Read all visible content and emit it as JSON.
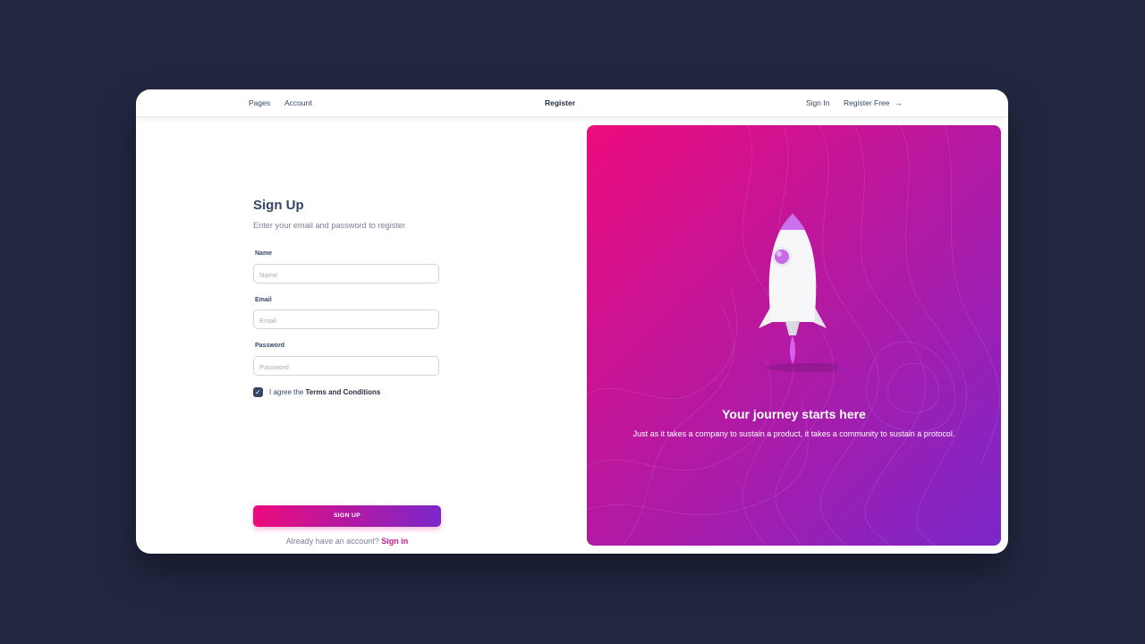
{
  "nav": {
    "pages": "Pages",
    "account": "Account",
    "title": "Register",
    "sign_in": "Sign In",
    "register_free": "Register Free",
    "arrow_icon": "arrow-right-icon"
  },
  "form": {
    "title": "Sign Up",
    "subtitle": "Enter your email and password to register",
    "name_label": "Name",
    "name_placeholder": "Name",
    "email_label": "Email",
    "email_placeholder": "Email",
    "password_label": "Password",
    "password_placeholder": "Password",
    "agree_prefix": "I agree the ",
    "agree_link": "Terms and Conditions",
    "agree_checked": true,
    "submit_label": "SIGN UP",
    "footer_text": "Already have an account? ",
    "footer_link": "Sign in"
  },
  "hero": {
    "title": "Your journey starts here",
    "text": "Just as it takes a company to sustain a product, it takes a community to sustain a protocol.",
    "illustration_icon": "rocket-icon"
  },
  "colors": {
    "page_background": "#222741",
    "gradient_start": "#ec0b7c",
    "gradient_end": "#7b27c9",
    "link_accent": "#c21c8c",
    "text_dark": "#344767"
  }
}
